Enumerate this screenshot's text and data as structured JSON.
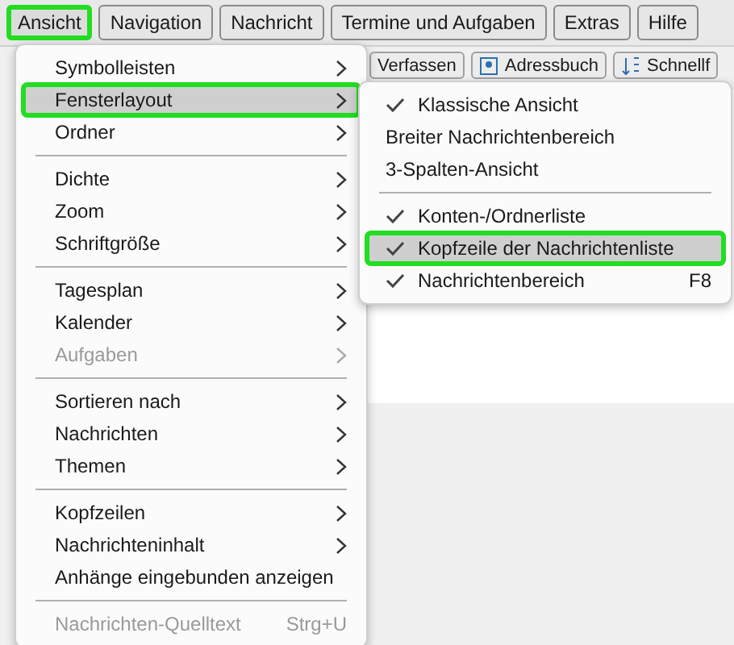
{
  "menubar": [
    {
      "label": "Ansicht",
      "selected": true
    },
    {
      "label": "Navigation",
      "selected": false
    },
    {
      "label": "Nachricht",
      "selected": false
    },
    {
      "label": "Termine und Aufgaben",
      "selected": false
    },
    {
      "label": "Extras",
      "selected": false
    },
    {
      "label": "Hilfe",
      "selected": false
    }
  ],
  "toolbar": [
    {
      "label": "Verfassen",
      "kind": "plain"
    },
    {
      "label": "Adressbuch",
      "kind": "addressbook"
    },
    {
      "label": "Schnellf",
      "kind": "filter"
    }
  ],
  "menu": {
    "items": [
      {
        "kind": "item",
        "label": "Symbolleisten",
        "submenu": true,
        "disabled": false,
        "selected": false
      },
      {
        "kind": "item",
        "label": "Fensterlayout",
        "submenu": true,
        "disabled": false,
        "selected": true
      },
      {
        "kind": "item",
        "label": "Ordner",
        "submenu": true,
        "disabled": false,
        "selected": false
      },
      {
        "kind": "separator"
      },
      {
        "kind": "item",
        "label": "Dichte",
        "submenu": true,
        "disabled": false,
        "selected": false
      },
      {
        "kind": "item",
        "label": "Zoom",
        "submenu": true,
        "disabled": false,
        "selected": false
      },
      {
        "kind": "item",
        "label": "Schriftgröße",
        "submenu": true,
        "disabled": false,
        "selected": false
      },
      {
        "kind": "separator"
      },
      {
        "kind": "item",
        "label": "Tagesplan",
        "submenu": true,
        "disabled": false,
        "selected": false
      },
      {
        "kind": "item",
        "label": "Kalender",
        "submenu": true,
        "disabled": false,
        "selected": false
      },
      {
        "kind": "item",
        "label": "Aufgaben",
        "submenu": true,
        "disabled": true,
        "selected": false
      },
      {
        "kind": "separator"
      },
      {
        "kind": "item",
        "label": "Sortieren nach",
        "submenu": true,
        "disabled": false,
        "selected": false
      },
      {
        "kind": "item",
        "label": "Nachrichten",
        "submenu": true,
        "disabled": false,
        "selected": false
      },
      {
        "kind": "item",
        "label": "Themen",
        "submenu": true,
        "disabled": false,
        "selected": false
      },
      {
        "kind": "separator"
      },
      {
        "kind": "item",
        "label": "Kopfzeilen",
        "submenu": true,
        "disabled": false,
        "selected": false
      },
      {
        "kind": "item",
        "label": "Nachrichteninhalt",
        "submenu": true,
        "disabled": false,
        "selected": false
      },
      {
        "kind": "item",
        "label": "Anhänge eingebunden anzeigen",
        "submenu": false,
        "disabled": false,
        "selected": false
      },
      {
        "kind": "separator"
      },
      {
        "kind": "item",
        "label": "Nachrichten-Quelltext",
        "submenu": false,
        "disabled": true,
        "selected": false,
        "shortcut": "Strg+U"
      }
    ]
  },
  "submenu": {
    "items": [
      {
        "kind": "item",
        "label": "Klassische Ansicht",
        "checked": true,
        "selected": false
      },
      {
        "kind": "item",
        "label": "Breiter Nachrichtenbereich",
        "checked": false,
        "selected": false
      },
      {
        "kind": "item",
        "label": "3-Spalten-Ansicht",
        "checked": false,
        "selected": false
      },
      {
        "kind": "separator"
      },
      {
        "kind": "item",
        "label": "Konten-/Ordnerliste",
        "checked": true,
        "selected": false
      },
      {
        "kind": "item",
        "label": "Kopfzeile der Nachrichtenliste",
        "checked": true,
        "selected": true
      },
      {
        "kind": "item",
        "label": "Nachrichtenbereich",
        "checked": true,
        "selected": false,
        "shortcut": "F8"
      }
    ]
  }
}
